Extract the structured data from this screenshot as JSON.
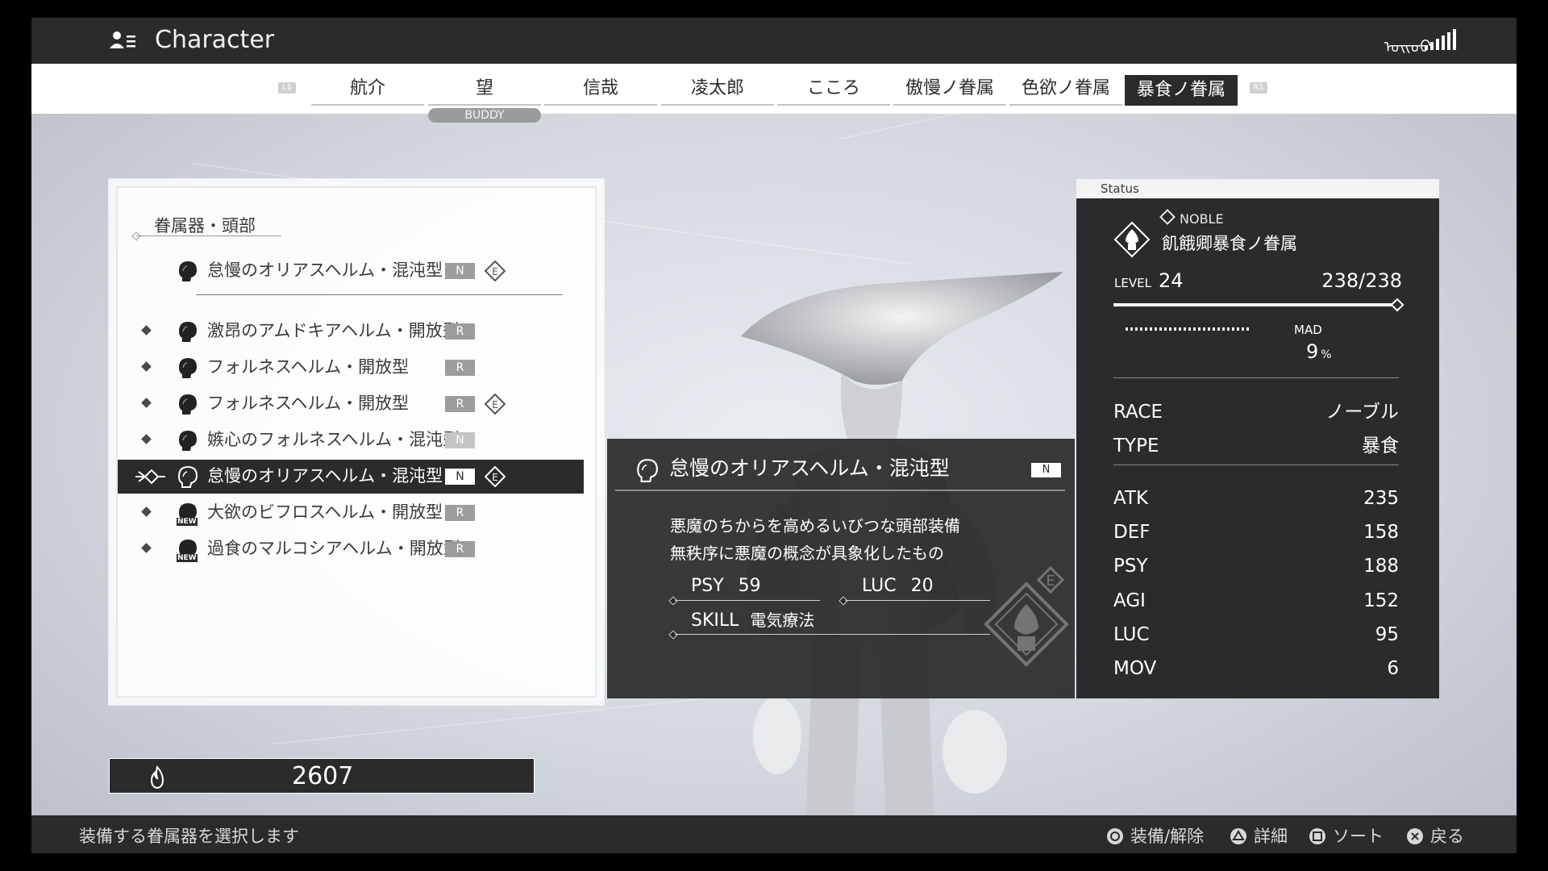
{
  "header": {
    "title": "Character",
    "glyphs": "ᠣᠢᠣᠥ"
  },
  "tabs": {
    "left_button": "L1",
    "right_button": "R1",
    "items": [
      "航介",
      "望",
      "信哉",
      "凌太郎",
      "こころ",
      "傲慢ノ眷属",
      "色欲ノ眷属",
      "暴食ノ眷属"
    ],
    "active_index": 7,
    "buddy_label": "BUDDY"
  },
  "equip_list": {
    "section_title": "眷属器・頭部",
    "equipped": {
      "name": "怠慢のオリアスヘルム・混沌型",
      "rarity": "N",
      "equipped_mark": "E"
    },
    "items": [
      {
        "name": "激昂のアムドキアヘルム・開放型",
        "rarity": "R"
      },
      {
        "name": "フォルネスヘルム・開放型",
        "rarity": "R"
      },
      {
        "name": "フォルネスヘルム・開放型",
        "rarity": "R",
        "equipped_mark": "E"
      },
      {
        "name": "嫉心のフォルネスヘルム・混沌型",
        "rarity": "N"
      },
      {
        "name": "怠慢のオリアスヘルム・混沌型",
        "rarity": "N",
        "equipped_mark": "E"
      },
      {
        "name": "大欲のビフロスヘルム・開放型",
        "rarity": "R",
        "new_tag": "NEW"
      },
      {
        "name": "過食のマルコシアヘルム・開放型",
        "rarity": "R",
        "new_tag": "NEW"
      }
    ],
    "selected_index": 4
  },
  "detail": {
    "name": "怠慢のオリアスヘルム・混沌型",
    "rarity": "N",
    "description": [
      "悪魔のちからを高めるいびつな頭部装備",
      "無秩序に悪魔の概念が具象化したもの"
    ],
    "stats": [
      {
        "label": "PSY",
        "value": "59"
      },
      {
        "label": "LUC",
        "value": "20"
      }
    ],
    "skill": {
      "label": "SKILL",
      "value": "電気療法"
    },
    "emblem_letter": "E"
  },
  "status": {
    "header": "Status",
    "race_class": "NOBLE",
    "demon_name": "飢餓卿暴食ノ眷属",
    "level_label": "LEVEL",
    "level": "24",
    "hp": "238/238",
    "hp_fraction": 1.0,
    "mad_label": "MAD",
    "mad_value": "9",
    "mad_unit": "%",
    "race_label": "RACE",
    "race_value": "ノーブル",
    "type_label": "TYPE",
    "type_value": "暴食",
    "stats": [
      {
        "label": "ATK",
        "value": "235"
      },
      {
        "label": "DEF",
        "value": "158"
      },
      {
        "label": "PSY",
        "value": "188"
      },
      {
        "label": "AGI",
        "value": "152"
      },
      {
        "label": "LUC",
        "value": "95"
      },
      {
        "label": "MOV",
        "value": "6"
      }
    ]
  },
  "currency": {
    "amount": "2607"
  },
  "footer": {
    "hint": "装備する眷属器を選択します",
    "buttons": [
      {
        "icon": "circle-button-icon",
        "label": "装備/解除"
      },
      {
        "icon": "triangle-button-icon",
        "label": "詳細"
      },
      {
        "icon": "square-button-icon",
        "label": "ソート"
      },
      {
        "icon": "cross-button-icon",
        "label": "戻る"
      }
    ]
  }
}
